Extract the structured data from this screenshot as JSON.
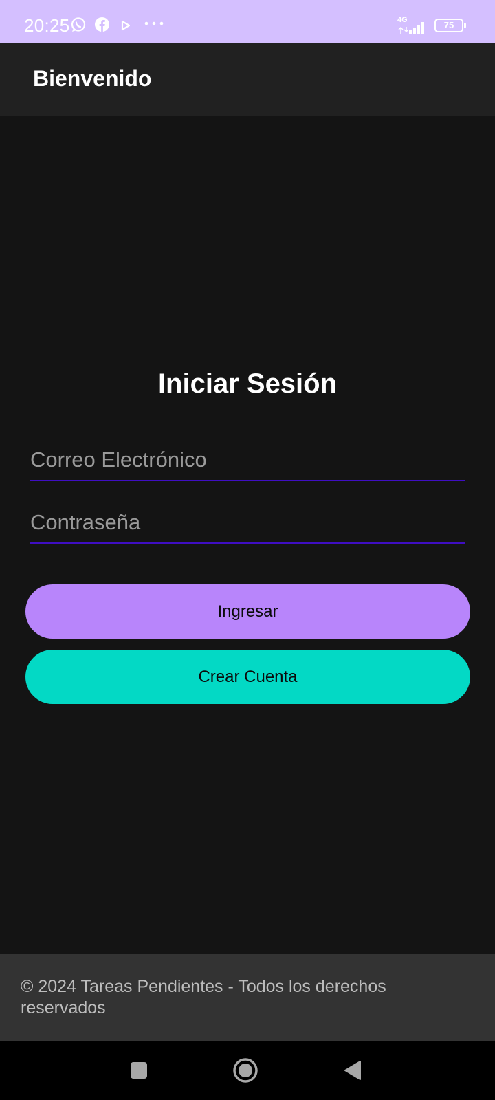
{
  "status_bar": {
    "time": "20:25",
    "icons": [
      "whatsapp-icon",
      "facebook-icon",
      "play-icon",
      "more-icon"
    ],
    "network": "4G",
    "battery_level": "75",
    "background_color": "#d4bfff"
  },
  "app_bar": {
    "title": "Bienvenido"
  },
  "login": {
    "title": "Iniciar Sesión",
    "email_placeholder": "Correo Electrónico",
    "email_value": "",
    "password_placeholder": "Contraseña",
    "password_value": "",
    "login_button": "Ingresar",
    "create_button": "Crear Cuenta"
  },
  "footer": {
    "text": "© 2024 Tareas Pendientes - Todos los derechos reservados"
  },
  "nav_bar": {
    "icons": [
      "recents-icon",
      "home-icon",
      "back-icon"
    ]
  },
  "colors": {
    "background": "#141414",
    "app_bar": "#212121",
    "primary_button": "#b885fb",
    "secondary_button": "#03d9c5",
    "field_underline": "#3f0ec2",
    "footer": "#333333"
  }
}
